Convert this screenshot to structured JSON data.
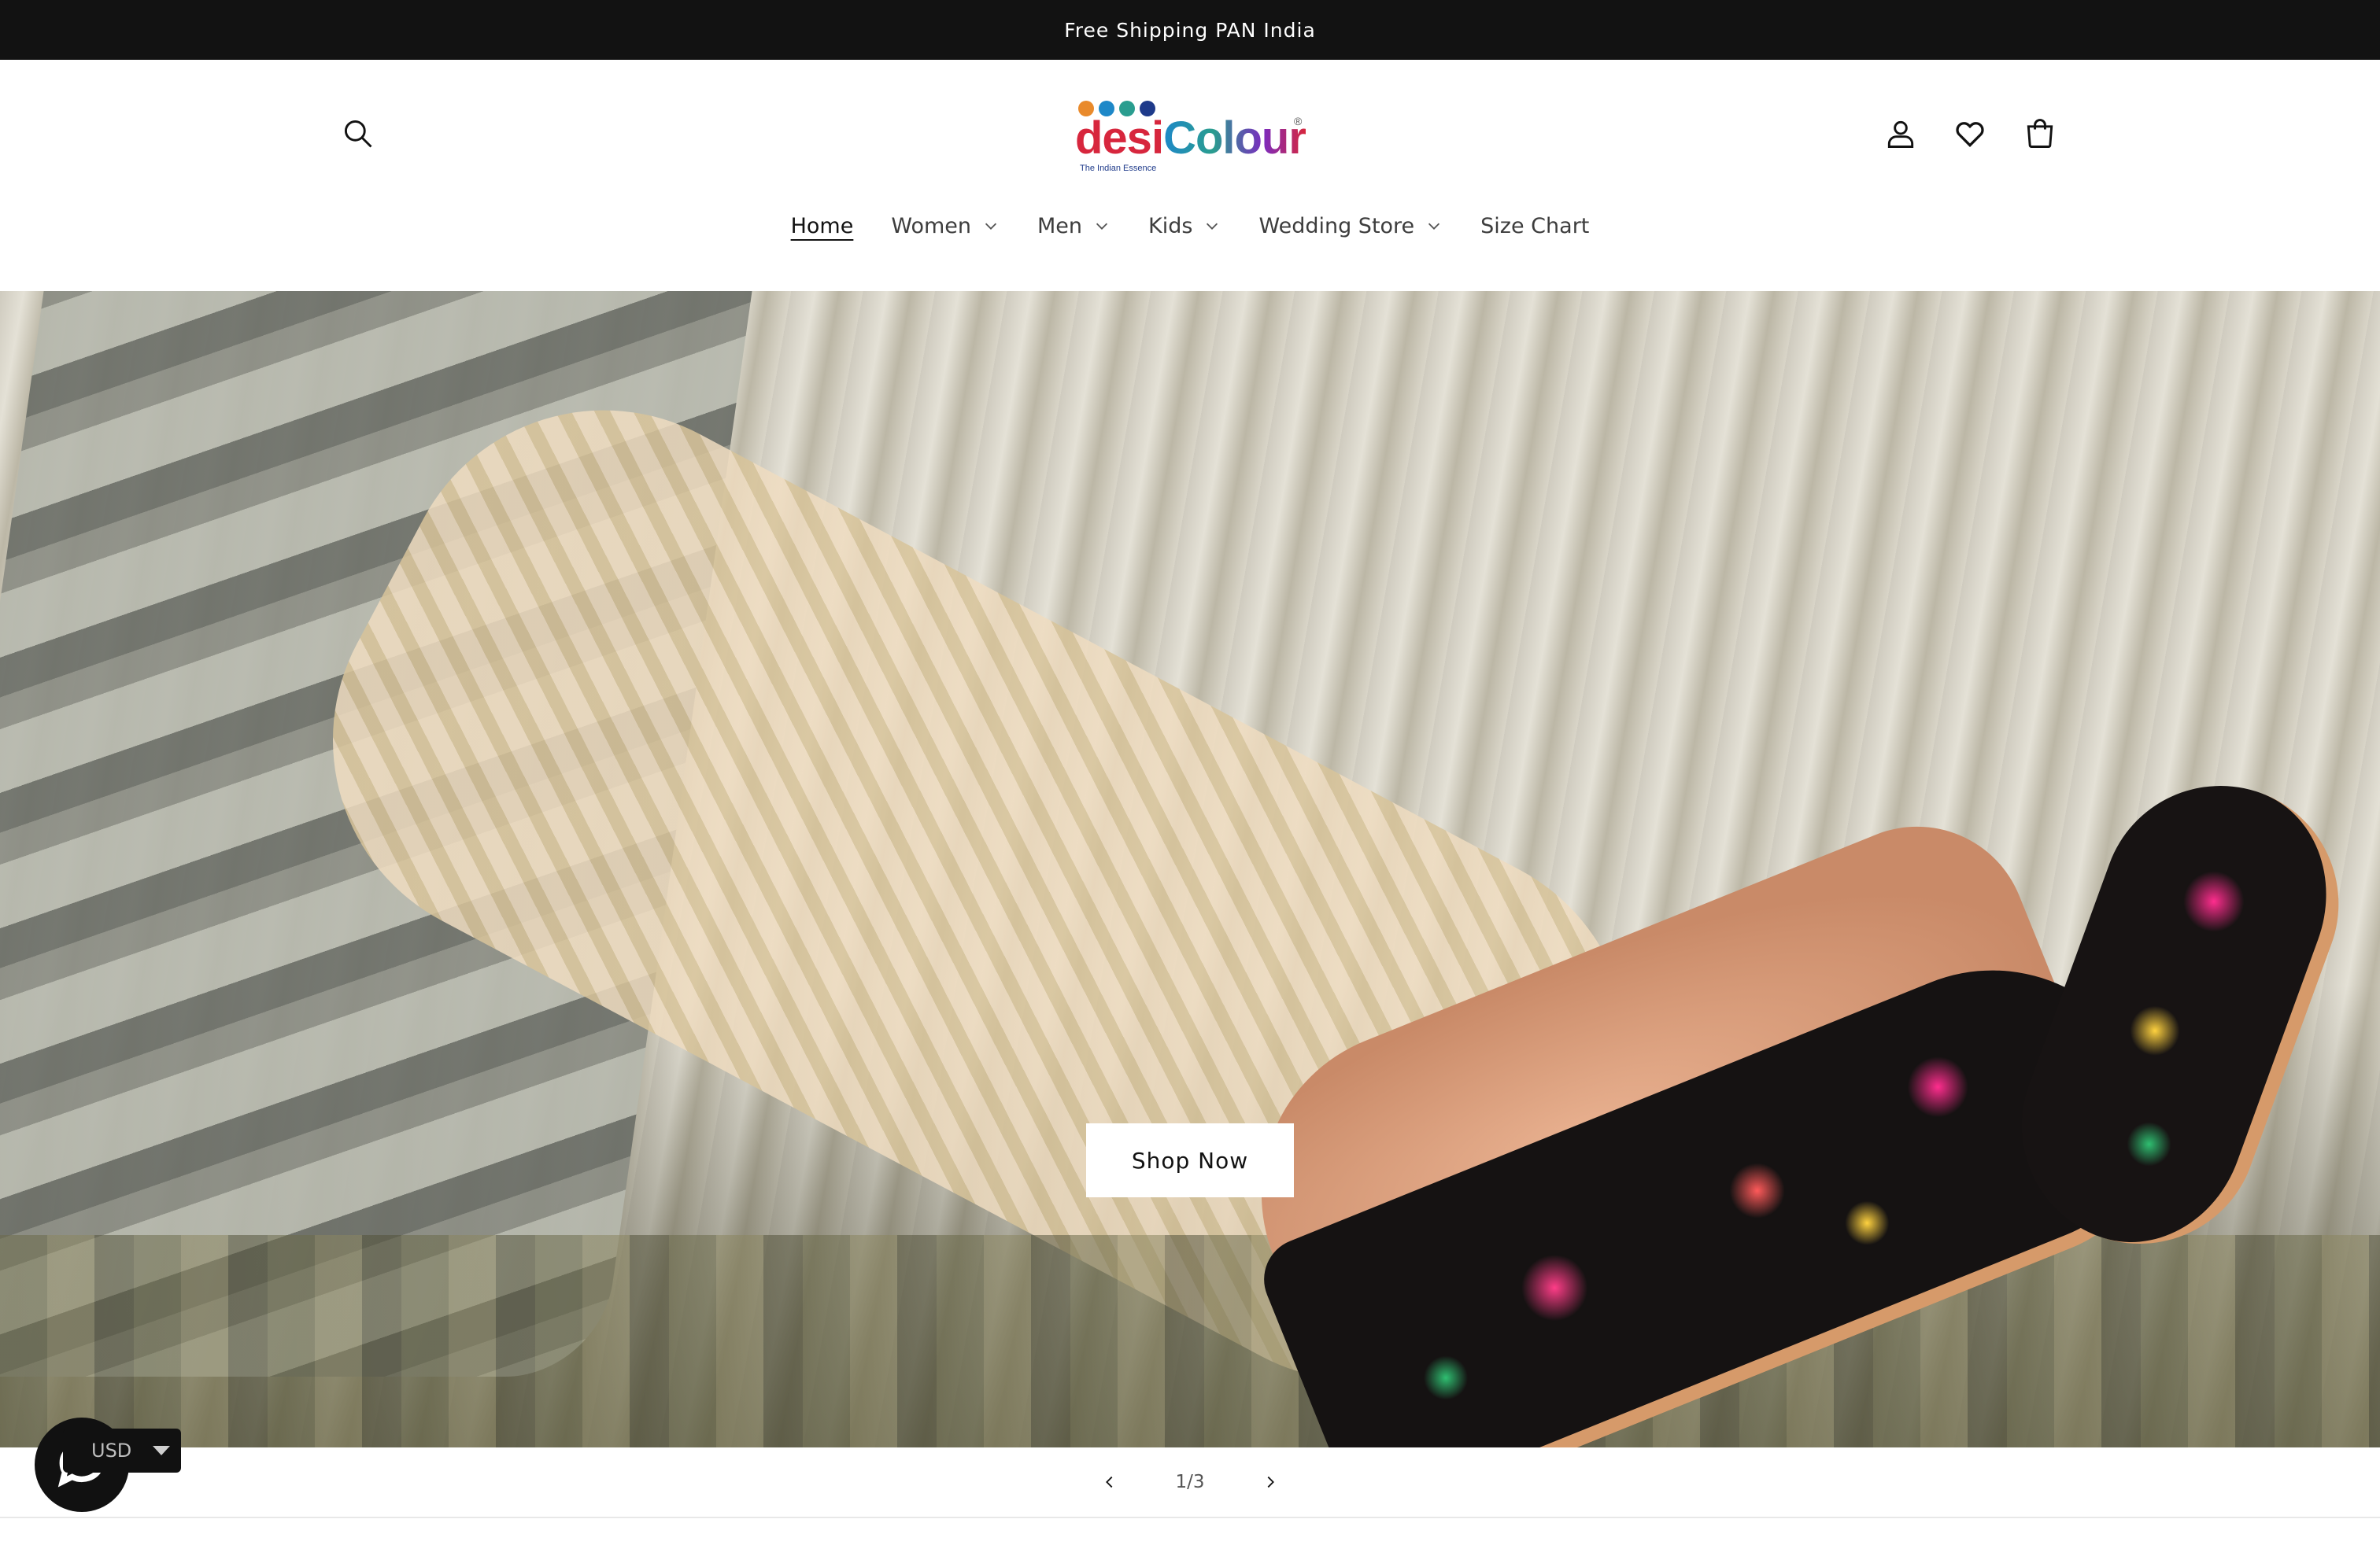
{
  "announcement": {
    "text": "Free Shipping PAN India"
  },
  "logo": {
    "word_desi": "desi",
    "word_colour": "Colour",
    "registered": "®",
    "tagline": "The Indian Essence",
    "dot_colors": [
      "#e98a2b",
      "#1e88c8",
      "#2a9d8f",
      "#1e3a8a"
    ]
  },
  "header_icons": {
    "search": "search-icon",
    "account": "account-icon",
    "wishlist": "heart-icon",
    "cart": "cart-icon"
  },
  "nav": {
    "items": [
      {
        "label": "Home",
        "active": true,
        "has_dropdown": false
      },
      {
        "label": "Women",
        "active": false,
        "has_dropdown": true
      },
      {
        "label": "Men",
        "active": false,
        "has_dropdown": true
      },
      {
        "label": "Kids",
        "active": false,
        "has_dropdown": true
      },
      {
        "label": "Wedding Store",
        "active": false,
        "has_dropdown": true
      },
      {
        "label": "Size Chart",
        "active": false,
        "has_dropdown": false
      }
    ]
  },
  "hero": {
    "cta_label": "Shop Now"
  },
  "slider": {
    "counter": "1/3",
    "prev_icon": "chevron-left-icon",
    "next_icon": "chevron-right-icon"
  },
  "widgets": {
    "currency": "USD",
    "chat_icon": "chat-bubble-icon"
  },
  "colors": {
    "announcement_bg": "#121212",
    "text": "#121212",
    "background": "#ffffff"
  }
}
